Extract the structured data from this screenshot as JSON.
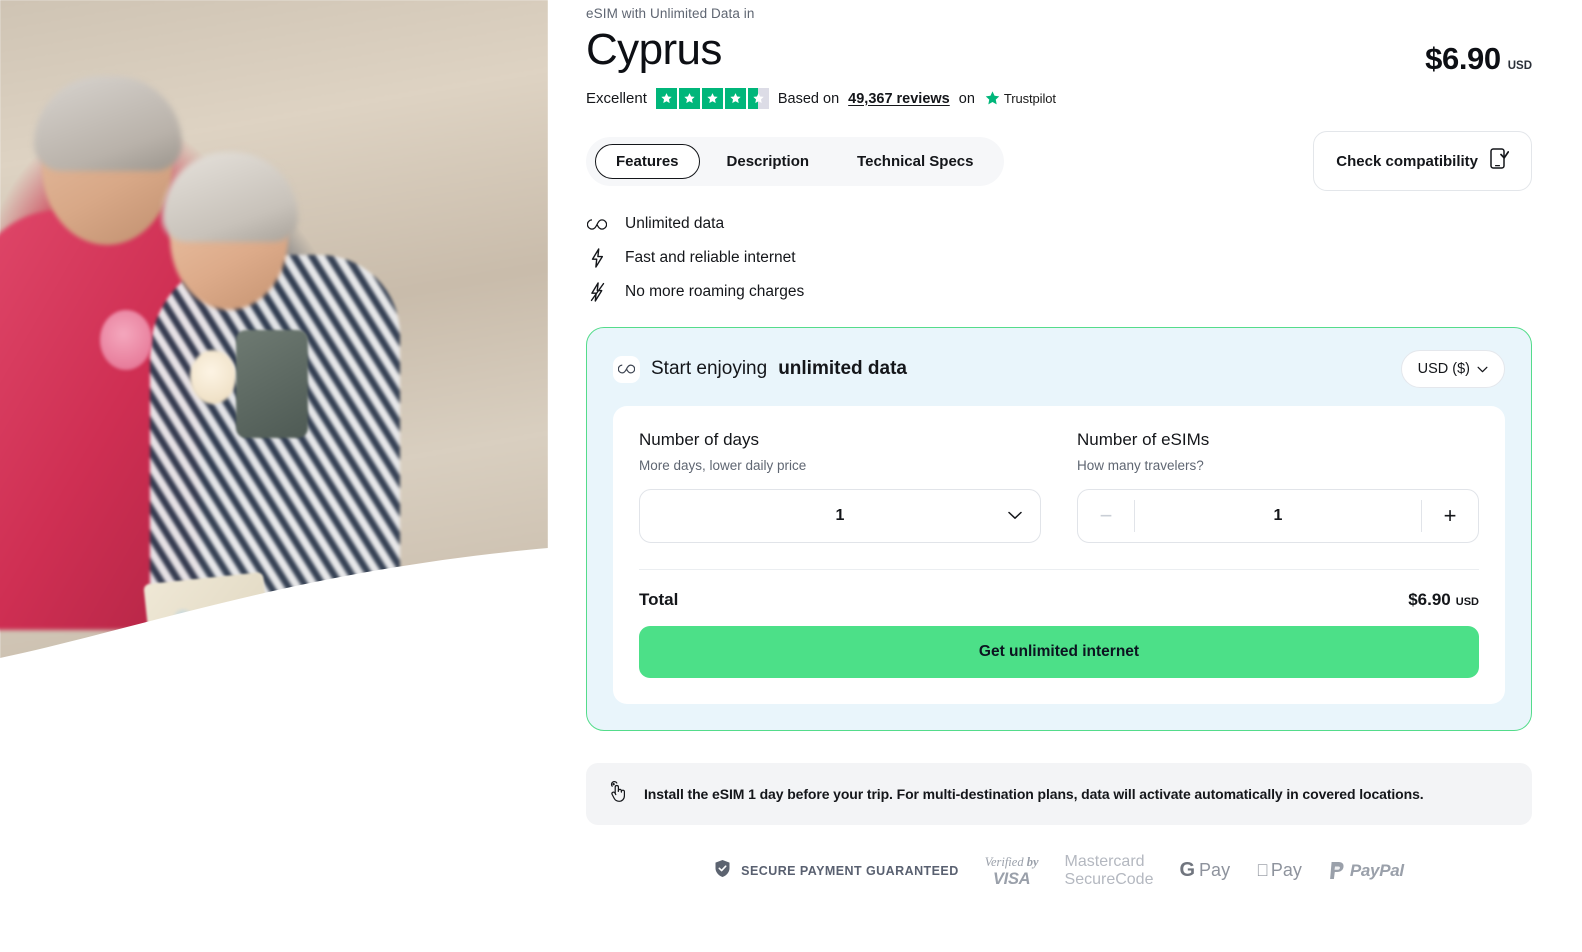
{
  "hero": {
    "alt_name": "couple-eating-ice-cream-photo"
  },
  "header": {
    "eyebrow": "eSIM with Unlimited Data in",
    "title": "Cyprus",
    "price_amount": "$6.90",
    "price_currency": "USD"
  },
  "trustpilot": {
    "rating_word": "Excellent",
    "stars_filled": 4.5,
    "based_on": "Based on",
    "reviews": "49,367 reviews",
    "on": "on",
    "brand": "Trustpilot",
    "star_color": "#00b67a",
    "star_empty_color": "#dcdce6"
  },
  "tabs": [
    {
      "label": "Features",
      "active": true
    },
    {
      "label": "Description",
      "active": false
    },
    {
      "label": "Technical Specs",
      "active": false
    }
  ],
  "check_compatibility": {
    "label": "Check compatibility",
    "icon": "phone-check-icon"
  },
  "features": [
    {
      "icon": "infinity-icon",
      "label": "Unlimited data"
    },
    {
      "icon": "bolt-icon",
      "label": "Fast and reliable internet"
    },
    {
      "icon": "bolt-slash-icon",
      "label": "No more roaming charges"
    }
  ],
  "buy_card": {
    "heading_prefix": "Start enjoying ",
    "heading_strong": "unlimited data",
    "heading_icon": "infinity-icon",
    "currency_selector": "USD ($)",
    "border_color": "#54dc8b",
    "background_color": "#e9f5fb",
    "days": {
      "title": "Number of days",
      "subtitle": "More days, lower daily price",
      "value": "1"
    },
    "esims": {
      "title": "Number of eSIMs",
      "subtitle": "How many travelers?",
      "value": "1",
      "minus": "−",
      "plus": "+",
      "minus_disabled": true
    },
    "total": {
      "label": "Total",
      "amount": "$6.90",
      "currency": "USD"
    },
    "cta": {
      "label": "Get unlimited internet",
      "color": "#4ce088"
    }
  },
  "notice": {
    "icon": "tap-hand-icon",
    "text": "Install the eSIM 1 day before your trip. For multi-destination plans, data will activate automatically in covered locations."
  },
  "footer": {
    "secure_icon": "shield-check-icon",
    "secure_text": "SECURE PAYMENT GUARANTEED",
    "visa": {
      "line1_a": "Verified ",
      "line1_b": "by",
      "line2": "VISA"
    },
    "mastercard": {
      "line1": "Mastercard",
      "line2": "SecureCode"
    },
    "gpay": {
      "g": "G",
      "pay": "Pay"
    },
    "apay": {
      "apple": "",
      "pay": "Pay"
    },
    "paypal": {
      "p_mark": "P",
      "name": "PayPal"
    }
  }
}
